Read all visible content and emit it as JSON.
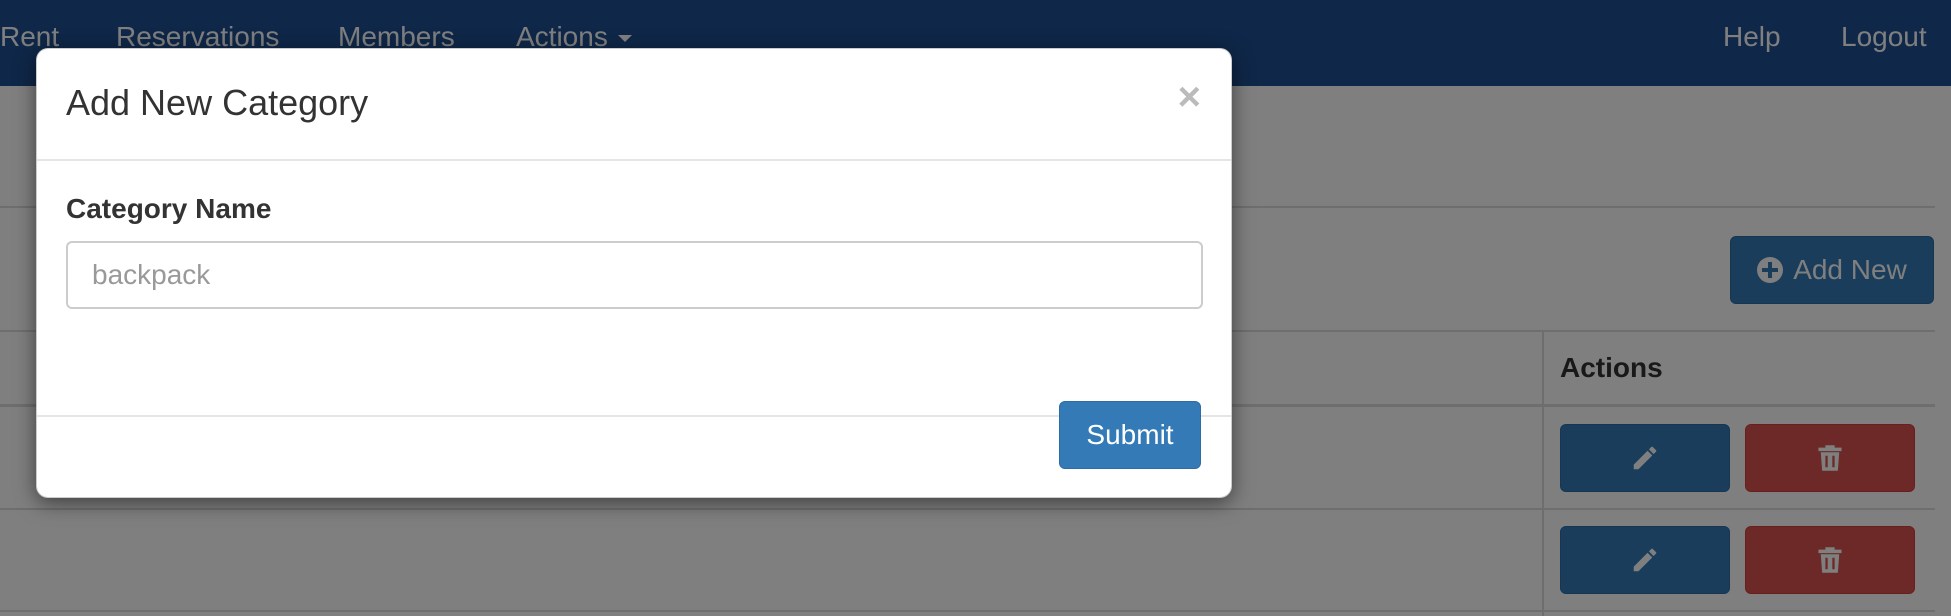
{
  "navbar": {
    "items": [
      {
        "label": "Rent"
      },
      {
        "label": "Reservations"
      },
      {
        "label": "Members"
      },
      {
        "label": "Actions"
      }
    ],
    "right": [
      {
        "label": "Help"
      },
      {
        "label": "Logout"
      }
    ],
    "color": "#1e4f91"
  },
  "page": {
    "add_new_label": "Add New",
    "table": {
      "actions_header": "Actions",
      "row_count_visible": 2
    }
  },
  "modal": {
    "title": "Add New Category",
    "close_glyph": "×",
    "field_label": "Category Name",
    "field_placeholder": "backpack",
    "field_value": "",
    "submit_label": "Submit"
  },
  "icons": {
    "add": "plus-circle-icon",
    "edit": "pencil-icon",
    "delete": "trash-icon",
    "close": "close-icon",
    "dropdown": "caret-down-icon"
  },
  "colors": {
    "primary": "#337ab7",
    "danger": "#d9534f",
    "navbar": "#1e4f91"
  }
}
